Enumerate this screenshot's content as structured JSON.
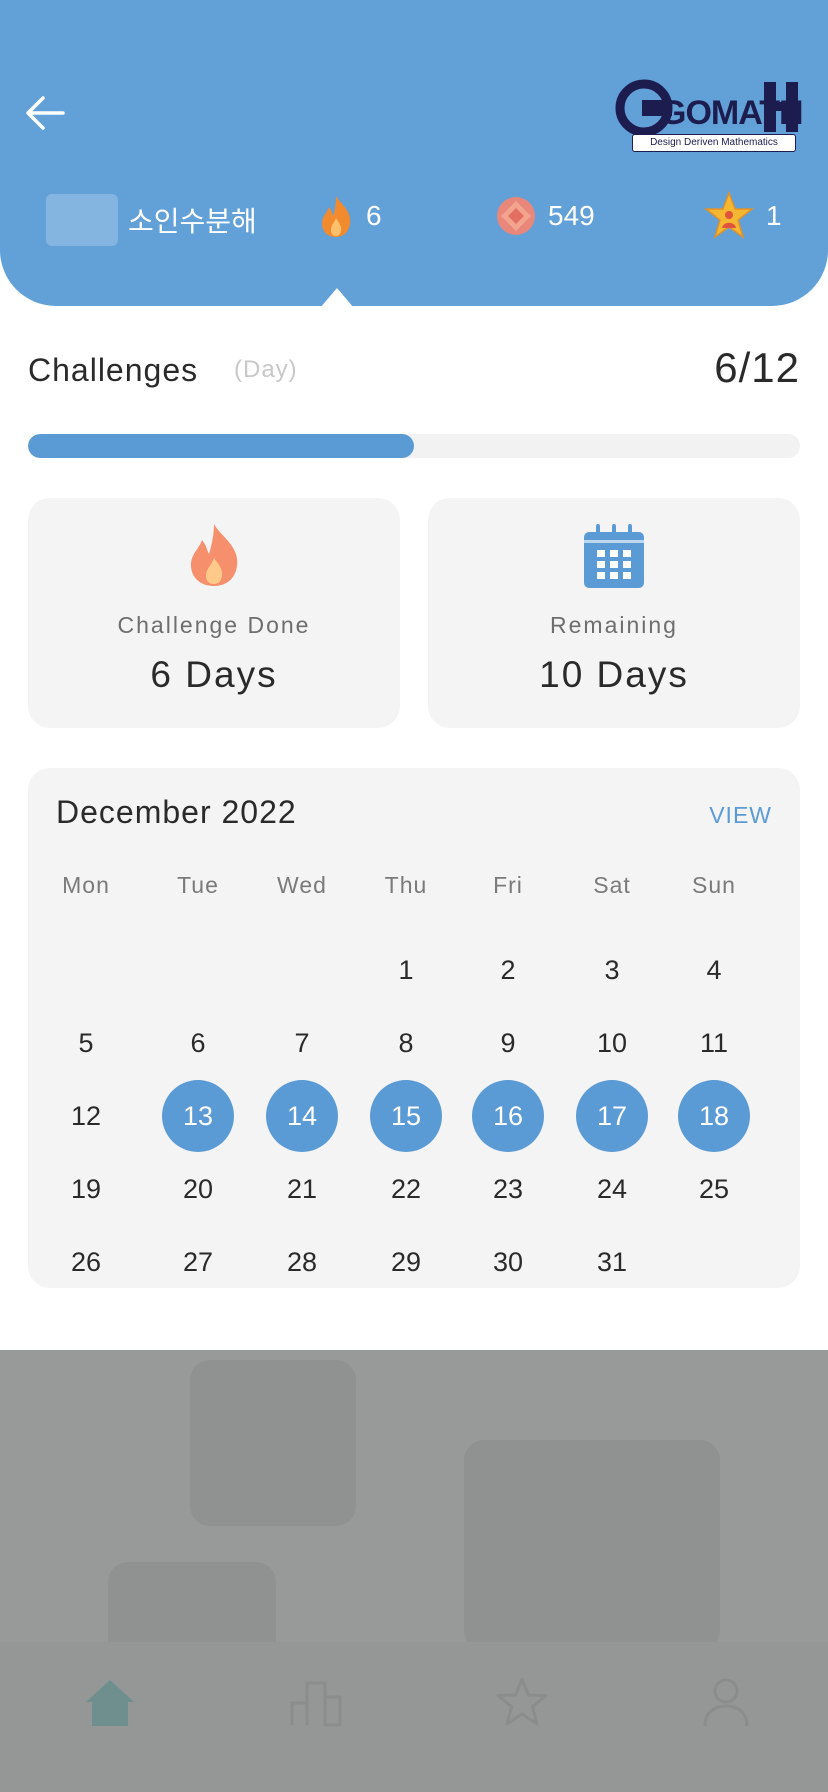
{
  "header": {
    "logo": {
      "text": "GOMATH",
      "tagline": "Design Deriven Mathematics"
    },
    "topic_label": "소인수분해",
    "stats": {
      "fire": "6",
      "gems": "549",
      "stars": "1"
    },
    "colors": {
      "background": "#62a0d8",
      "fire": "#f28a2e",
      "gem": "#e9877a",
      "star": "#f5b731"
    }
  },
  "challenges": {
    "title": "Challenges",
    "subtitle": "(Day)",
    "count": "6/12",
    "progress_fraction": 0.5
  },
  "cards": [
    {
      "icon": "fire-icon",
      "label": "Challenge Done",
      "value": "6 Days"
    },
    {
      "icon": "calendar-icon",
      "label": "Remaining",
      "value": "10 Days"
    }
  ],
  "calendar": {
    "title": "December 2022",
    "view_label": "VIEW",
    "weekdays": [
      "Mon",
      "Tue",
      "Wed",
      "Thu",
      "Fri",
      "Sat",
      "Sun"
    ],
    "weeks": [
      [
        "",
        "",
        "",
        "1",
        "2",
        "3",
        "4"
      ],
      [
        "5",
        "6",
        "7",
        "8",
        "9",
        "10",
        "11"
      ],
      [
        "12",
        "13",
        "14",
        "15",
        "16",
        "17",
        "18"
      ],
      [
        "19",
        "20",
        "21",
        "22",
        "23",
        "24",
        "25"
      ],
      [
        "26",
        "27",
        "28",
        "29",
        "30",
        "31",
        ""
      ]
    ],
    "selected_days": [
      "13",
      "14",
      "15",
      "16",
      "17",
      "18"
    ],
    "accent": "#5b9bd5"
  },
  "bottom_nav": [
    {
      "icon": "home-icon",
      "active": true
    },
    {
      "icon": "leaderboard-icon",
      "active": false
    },
    {
      "icon": "star-icon",
      "active": false
    },
    {
      "icon": "profile-icon",
      "active": false
    }
  ]
}
